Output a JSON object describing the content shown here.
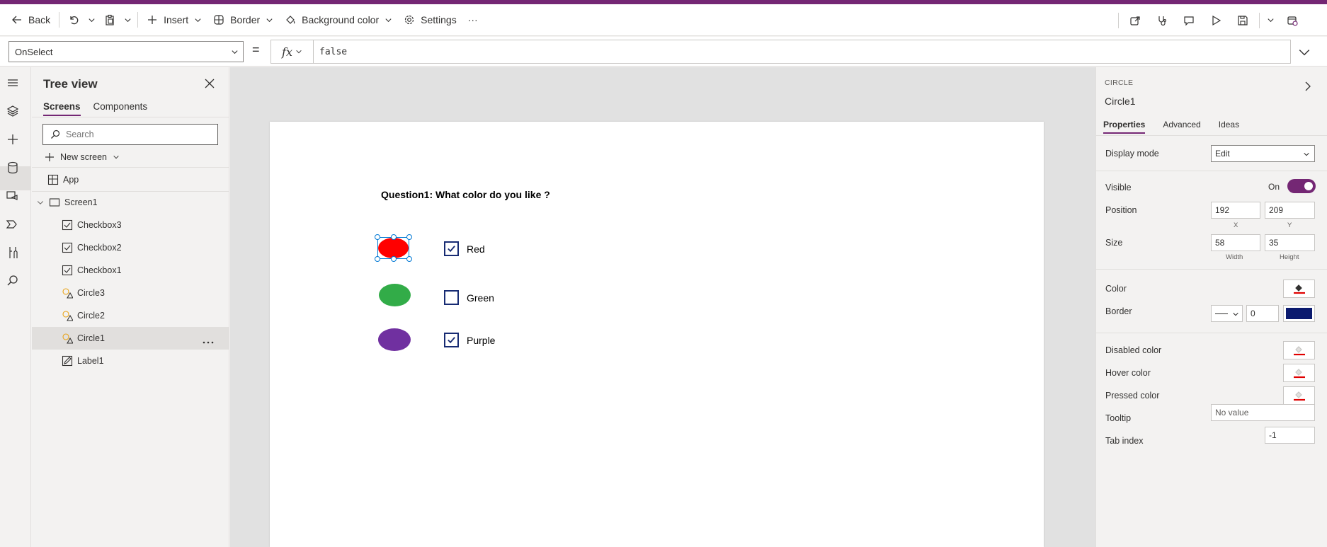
{
  "toolbar": {
    "back": "Back",
    "insert": "Insert",
    "border": "Border",
    "background_color": "Background color",
    "settings": "Settings",
    "more": "···"
  },
  "formula": {
    "property": "OnSelect",
    "equals": "=",
    "fx": "fx",
    "value": "false"
  },
  "tree": {
    "title": "Tree view",
    "tabs": [
      "Screens",
      "Components"
    ],
    "search_placeholder": "Search",
    "new_screen": "New screen",
    "app": "App",
    "screen": "Screen1",
    "items": [
      "Checkbox3",
      "Checkbox2",
      "Checkbox1",
      "Circle3",
      "Circle2",
      "Circle1",
      "Label1"
    ],
    "selected": "Circle1"
  },
  "canvas": {
    "question": "Question1: What color do you like ?",
    "options": [
      {
        "label": "Red",
        "checked": true,
        "color": "#ff0000"
      },
      {
        "label": "Green",
        "checked": false,
        "color": "#32ac48"
      },
      {
        "label": "Purple",
        "checked": true,
        "color": "#7030a0"
      }
    ]
  },
  "props": {
    "type": "CIRCLE",
    "name": "Circle1",
    "tabs": [
      "Properties",
      "Advanced",
      "Ideas"
    ],
    "display_mode_label": "Display mode",
    "display_mode": "Edit",
    "visible_label": "Visible",
    "visible_state": "On",
    "position_label": "Position",
    "x": "192",
    "y": "209",
    "x_sub": "X",
    "y_sub": "Y",
    "size_label": "Size",
    "width": "58",
    "height": "35",
    "width_sub": "Width",
    "height_sub": "Height",
    "color_label": "Color",
    "border_label": "Border",
    "border_width": "0",
    "border_color": "#0b1a6e",
    "disabled_color_label": "Disabled color",
    "hover_color_label": "Hover color",
    "pressed_color_label": "Pressed color",
    "tooltip_label": "Tooltip",
    "tooltip_placeholder": "No value",
    "tab_index_label": "Tab index",
    "tab_index": "-1"
  },
  "colors": {
    "brand": "#742774",
    "selection": "#0078d4",
    "checkbox": "#172b73"
  }
}
